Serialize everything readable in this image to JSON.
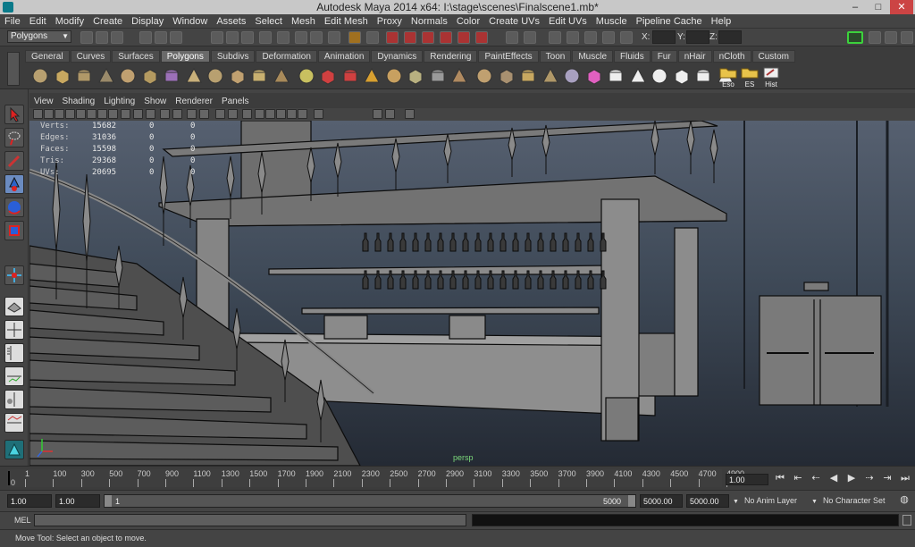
{
  "window": {
    "title": "Autodesk Maya 2014 x64: I:\\stage\\scenes\\Finalscene1.mb*",
    "minimize": "–",
    "maximize": "□",
    "close": "✕"
  },
  "menus": [
    "File",
    "Edit",
    "Modify",
    "Create",
    "Display",
    "Window",
    "Assets",
    "Select",
    "Mesh",
    "Edit Mesh",
    "Proxy",
    "Normals",
    "Color",
    "Create UVs",
    "Edit UVs",
    "Muscle",
    "Pipeline Cache",
    "Help"
  ],
  "status_line": {
    "mode": "Polygons",
    "x_label": "X:",
    "y_label": "Y:",
    "z_label": "Z:"
  },
  "shelf": {
    "tabs": [
      "General",
      "Curves",
      "Surfaces",
      "Polygons",
      "Subdivs",
      "Deformation",
      "Animation",
      "Dynamics",
      "Rendering",
      "PaintEffects",
      "Toon",
      "Muscle",
      "Fluids",
      "Fur",
      "nHair",
      "nCloth",
      "Custom"
    ],
    "active_tab": "Polygons",
    "labeled_buttons": [
      "Eso",
      "ES",
      "Hist"
    ]
  },
  "panel": {
    "menus": [
      "View",
      "Shading",
      "Lighting",
      "Show",
      "Renderer",
      "Panels"
    ],
    "hud": [
      {
        "label": "Verts:",
        "a": "15682",
        "b": "0",
        "c": "0"
      },
      {
        "label": "Edges:",
        "a": "31036",
        "b": "0",
        "c": "0"
      },
      {
        "label": "Faces:",
        "a": "15598",
        "b": "0",
        "c": "0"
      },
      {
        "label": "Tris:",
        "a": "29368",
        "b": "0",
        "c": "0"
      },
      {
        "label": "UVs:",
        "a": "20695",
        "b": "0",
        "c": "0"
      }
    ],
    "camera": "persp"
  },
  "timeline": {
    "ticks": [
      "1",
      "100",
      "300",
      "500",
      "700",
      "900",
      "1100",
      "1300",
      "1500",
      "1700",
      "1900",
      "2100",
      "2300",
      "2500",
      "2700",
      "2900",
      "3100",
      "3300",
      "3500",
      "3700",
      "3900",
      "4100",
      "4300",
      "4500",
      "4700",
      "4900"
    ],
    "start_marker": "0",
    "current_frame": "1.00"
  },
  "range": {
    "anim_start": "1.00",
    "playback_start": "1.00",
    "slider_start": "1",
    "slider_end": "5000",
    "playback_end": "5000.00",
    "anim_end": "5000.00",
    "anim_layer": "No Anim Layer",
    "character_set": "No Character Set"
  },
  "command_line": {
    "label": "MEL"
  },
  "help_line": "Move Tool: Select an object to move.",
  "colors": {
    "accent": "#21a0b0",
    "viewport_top": "#566070",
    "viewport_bottom": "#242a34",
    "hud_green": "#7bd87b"
  }
}
